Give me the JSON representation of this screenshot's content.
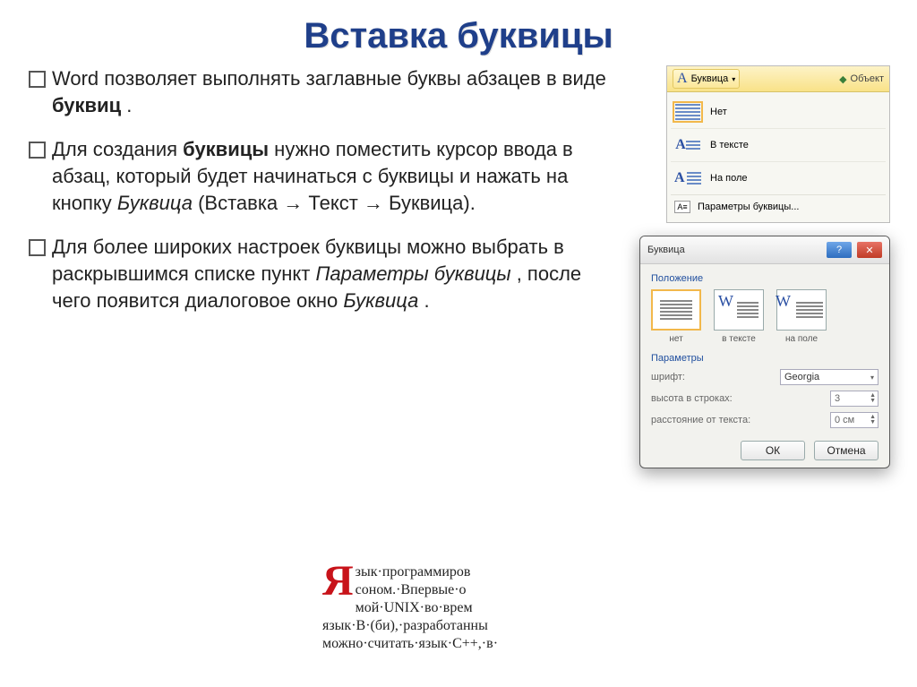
{
  "title": "Вставка буквицы",
  "bullets": {
    "b1a": "Word позволяет выполнять заглавные буквы абзацев в виде ",
    "b1b": "буквиц",
    "b1c": " .",
    "b2a": "Для создания ",
    "b2b": "буквицы",
    "b2c": " нужно поместить курсор ввода в абзац, который будет начинаться с буквицы и нажать на кнопку ",
    "b2d": "Буквица",
    "b2e": " (Вставка → Текст → Буквица).",
    "b3a": "Для более широких настроек буквицы можно выбрать в раскрывшимся списке пункт ",
    "b3b": "Параметры буквицы",
    "b3c": ", после чего появится диалоговое окно ",
    "b3d": "Буквица",
    "b3e": "."
  },
  "ribbon": {
    "btn": "Буквица",
    "obj": "Объект",
    "row1": "Нет",
    "row2": "В тексте",
    "row3": "На поле",
    "params": "Параметры буквицы..."
  },
  "dialog": {
    "title": "Буквица",
    "section1": "Положение",
    "pos1": "нет",
    "pos2": "в тексте",
    "pos3": "на поле",
    "section2": "Параметры",
    "fontLabel": "шрифт:",
    "fontValue": "Georgia",
    "heightLabel": "высота в строках:",
    "heightValue": "3",
    "distLabel": "расстояние от текста:",
    "distValue": "0 см",
    "ok": "ОК",
    "cancel": "Отмена"
  },
  "sample": {
    "cap": "Я",
    "l1": "зык·программиров",
    "l2": "соном.·Впервые·о",
    "l3": "мой·UNIX·во·врем",
    "l4": "язык·B·(би),·разработанны",
    "l5": "можно·считать·язык·C++,·в·"
  }
}
